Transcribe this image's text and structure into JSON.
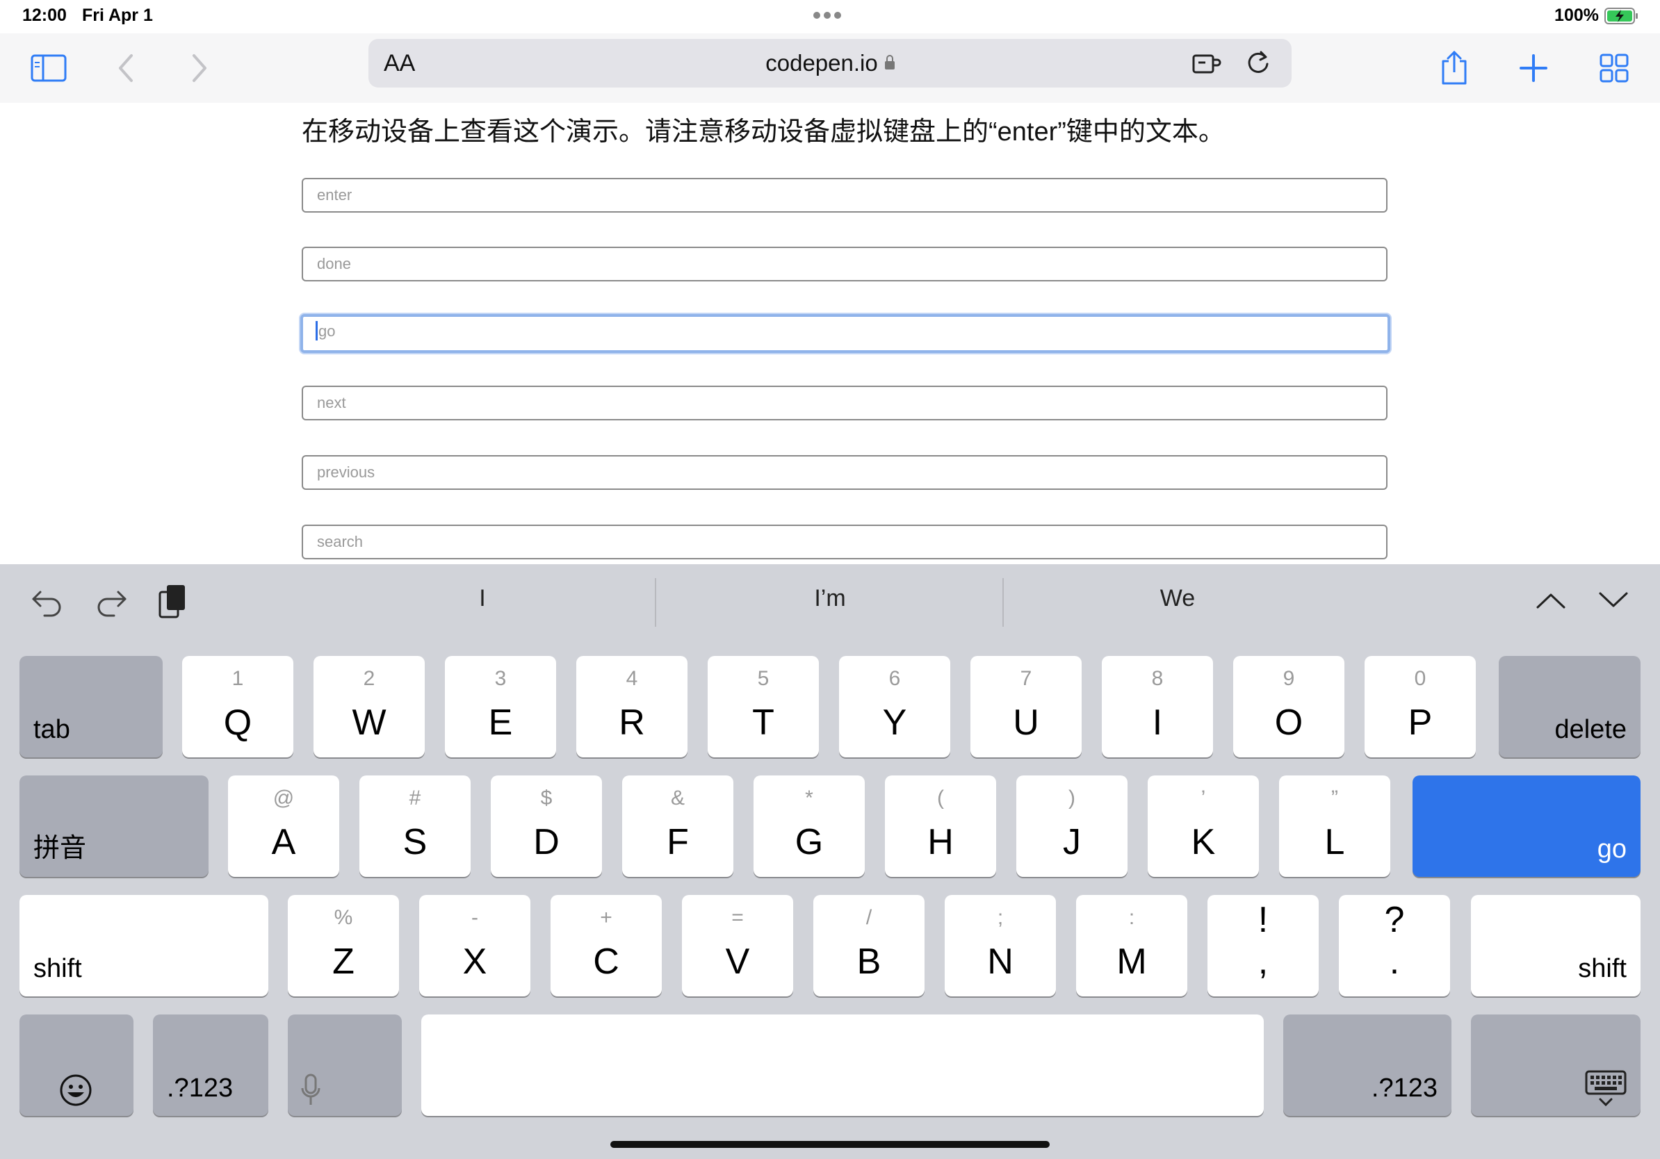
{
  "status_bar": {
    "time": "12:00",
    "date": "Fri Apr 1",
    "battery": "100%"
  },
  "toolbar": {
    "url_text_size_label": "AA",
    "domain": "codepen.io",
    "icons": [
      "sidebar-icon",
      "back-icon",
      "forward-icon",
      "extension-icon",
      "reload-icon",
      "share-icon",
      "new-tab-icon",
      "tabs-overview-icon"
    ]
  },
  "page": {
    "heading": "在移动设备上查看这个演示。请注意移动设备虚拟键盘上的“enter”键中的文本。",
    "fields": [
      {
        "placeholder": "enter",
        "focused": false
      },
      {
        "placeholder": "done",
        "focused": false
      },
      {
        "placeholder": "go",
        "focused": true
      },
      {
        "placeholder": "next",
        "focused": false
      },
      {
        "placeholder": "previous",
        "focused": false
      },
      {
        "placeholder": "search",
        "focused": false
      }
    ]
  },
  "keyboard": {
    "suggestions": [
      "I",
      "I’m",
      "We"
    ],
    "row1": [
      {
        "hint": "1",
        "main": "Q"
      },
      {
        "hint": "2",
        "main": "W"
      },
      {
        "hint": "3",
        "main": "E"
      },
      {
        "hint": "4",
        "main": "R"
      },
      {
        "hint": "5",
        "main": "T"
      },
      {
        "hint": "6",
        "main": "Y"
      },
      {
        "hint": "7",
        "main": "U"
      },
      {
        "hint": "8",
        "main": "I"
      },
      {
        "hint": "9",
        "main": "O"
      },
      {
        "hint": "0",
        "main": "P"
      }
    ],
    "row2": [
      {
        "hint": "@",
        "main": "A"
      },
      {
        "hint": "#",
        "main": "S"
      },
      {
        "hint": "$",
        "main": "D"
      },
      {
        "hint": "&",
        "main": "F"
      },
      {
        "hint": "*",
        "main": "G"
      },
      {
        "hint": "(",
        "main": "H"
      },
      {
        "hint": ")",
        "main": "J"
      },
      {
        "hint": "’",
        "main": "K"
      },
      {
        "hint": "”",
        "main": "L"
      }
    ],
    "row3": [
      {
        "hint": "%",
        "main": "Z"
      },
      {
        "hint": "-",
        "main": "X"
      },
      {
        "hint": "+",
        "main": "C"
      },
      {
        "hint": "=",
        "main": "V"
      },
      {
        "hint": "/",
        "main": "B"
      },
      {
        "hint": ";",
        "main": "N"
      },
      {
        "hint": ":",
        "main": "M"
      },
      {
        "hint": "!",
        "main": ","
      },
      {
        "hint": "?",
        "main": "."
      }
    ],
    "tab_label": "tab",
    "delete_label": "delete",
    "pinyin_label": "拼音",
    "go_label": "go",
    "shift_label": "shift",
    "numbers_label": ".?123",
    "go_key_color": "#2e74ea"
  }
}
